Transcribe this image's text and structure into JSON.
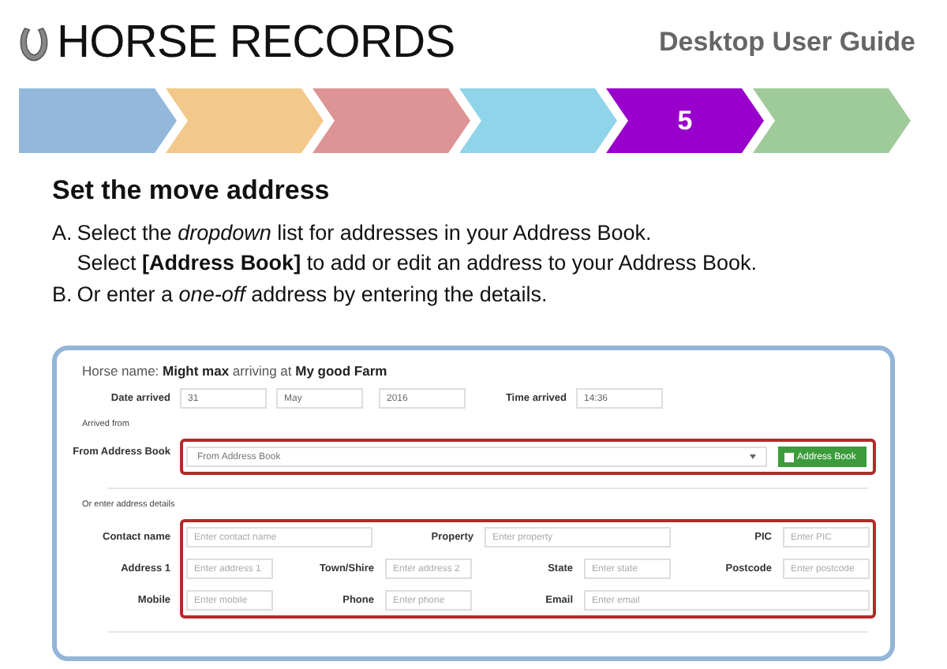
{
  "header": {
    "title": "HORSE RECORDS",
    "guide": "Desktop User Guide"
  },
  "steps": [
    {
      "color": "#93b8dc"
    },
    {
      "color": "#f2c98a"
    },
    {
      "color": "#dd9494"
    },
    {
      "color": "#90d4ea"
    },
    {
      "color": "#9a00cc",
      "label": "5"
    },
    {
      "color": "#9fcb9b"
    }
  ],
  "heading": "Set the move address",
  "instructions": [
    {
      "marker": "A.",
      "lines": [
        "Select the *dropdown* list for addresses in your Address Book.",
        "Select **[Address Book]** to add or edit an address to your Address Book."
      ]
    },
    {
      "marker": "B.",
      "lines": [
        "Or enter a *one-off* address by entering the details."
      ]
    }
  ],
  "form": {
    "horse_line": "Horse name: **Might max** arriving at **My good Farm**",
    "date_label": "Date arrived",
    "date_values": [
      "31",
      "May",
      "2016"
    ],
    "time_label": "Time arrived",
    "time_value": "14:36",
    "arrived_from": "Arrived from",
    "address_book_label": "From Address Book",
    "address_book_select": "From Address Book",
    "address_book_button": "Address Book",
    "manual_heading": "Or enter address details",
    "rows": [
      [
        {
          "label": "Contact name",
          "placeholder": "Enter contact name",
          "kind": "wide"
        },
        {
          "label": "Property",
          "placeholder": "Enter property",
          "kind": "wide"
        },
        {
          "kind": "gap"
        },
        {
          "label": "PIC",
          "placeholder": "Enter PIC",
          "kind": "small"
        }
      ],
      [
        {
          "label": "Address 1",
          "placeholder": "Enter address 1",
          "kind": "small"
        },
        {
          "label": "Town/Shire",
          "placeholder": "Enter address 2",
          "kind": "small"
        },
        {
          "label": "State",
          "placeholder": "Enter state",
          "kind": "small"
        },
        {
          "label": "Postcode",
          "placeholder": "Enter postcode",
          "kind": "small"
        }
      ],
      [
        {
          "label": "Mobile",
          "placeholder": "Enter mobile",
          "kind": "small"
        },
        {
          "label": "Phone",
          "placeholder": "Enter phone",
          "kind": "small"
        },
        {
          "label": "Email",
          "placeholder": "Enter email",
          "kind": "full"
        }
      ]
    ]
  }
}
